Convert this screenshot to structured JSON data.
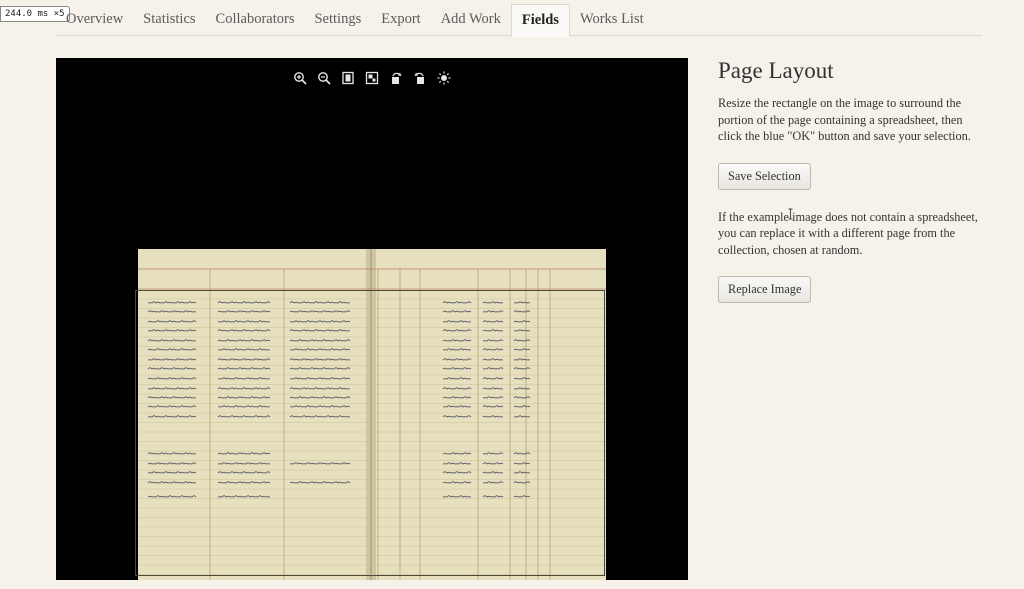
{
  "timing_badge": "244.0 ms ×5",
  "tabs": [
    {
      "label": "Overview"
    },
    {
      "label": "Statistics"
    },
    {
      "label": "Collaborators"
    },
    {
      "label": "Settings"
    },
    {
      "label": "Export"
    },
    {
      "label": "Add Work"
    },
    {
      "label": "Fields"
    },
    {
      "label": "Works List"
    }
  ],
  "active_tab": "Fields",
  "viewer": {
    "tools": [
      "zoom-in-icon",
      "zoom-out-icon",
      "fit-page-icon",
      "full-screen-icon",
      "rotate-left-icon",
      "rotate-right-icon",
      "brightness-icon"
    ]
  },
  "panel": {
    "title": "Page Layout",
    "instructions": "Resize the rectangle on the image to surround the portion of the page containing a spreadsheet, then click the blue \"OK\" button and save your selection.",
    "save_label": "Save Selection",
    "replace_hint": "If the example image does not contain a spreadsheet, you can replace it with a different page from the collection, chosen at random.",
    "replace_label": "Replace Image"
  },
  "colors": {
    "page_bg": "#f6f2ea",
    "viewer_bg": "#000000",
    "ledger_paper": "#e7e0be",
    "ledger_red_rule": "#b87a6a"
  }
}
